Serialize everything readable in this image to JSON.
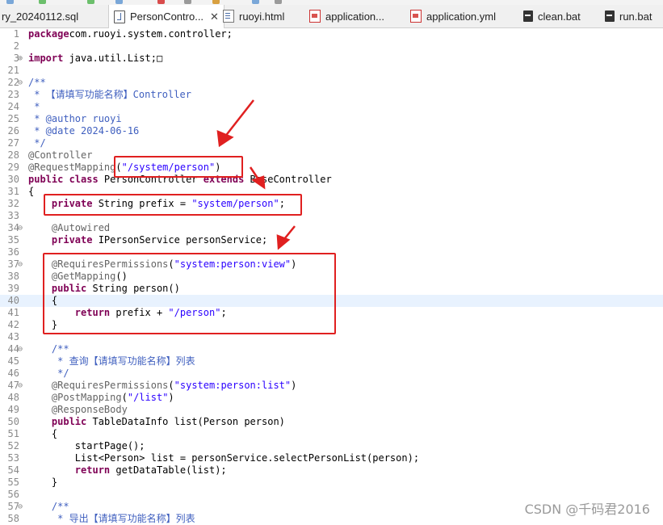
{
  "tabs": [
    {
      "label": "ry_20240112.sql",
      "icon": "none",
      "active": false
    },
    {
      "label": "PersonContro...",
      "icon": "java-file-icon",
      "active": true,
      "close": "✕"
    },
    {
      "label": "ruoyi.html",
      "icon": "html-file-icon",
      "active": false
    },
    {
      "label": "application...",
      "icon": "yml-file-icon",
      "active": false
    },
    {
      "label": "application.yml",
      "icon": "yml-file-icon",
      "active": false
    },
    {
      "label": "clean.bat",
      "icon": "bat-file-icon",
      "active": false
    },
    {
      "label": "run.bat",
      "icon": "bat-file-icon",
      "active": false
    }
  ],
  "editor": {
    "lines": [
      {
        "n": "1",
        "fold": "",
        "tokens": [
          [
            "kw",
            "package"
          ],
          [
            "",
            "com.ruoyi.system.controller;"
          ]
        ]
      },
      {
        "n": "2",
        "fold": "",
        "tokens": []
      },
      {
        "n": "3",
        "fold": "⊕",
        "tokens": [
          [
            "kw",
            "import"
          ],
          [
            "",
            " java.util.List;□"
          ]
        ]
      },
      {
        "n": "21",
        "fold": "",
        "tokens": []
      },
      {
        "n": "22",
        "fold": "⊖",
        "tokens": [
          [
            "jdoc",
            "/**"
          ]
        ]
      },
      {
        "n": "23",
        "fold": "",
        "tokens": [
          [
            "jdoc",
            " * 【请填写功能名称】Controller"
          ]
        ]
      },
      {
        "n": "24",
        "fold": "",
        "tokens": [
          [
            "jdoc",
            " *"
          ]
        ]
      },
      {
        "n": "25",
        "fold": "",
        "tokens": [
          [
            "jdoc",
            " * @author ruoyi"
          ]
        ]
      },
      {
        "n": "26",
        "fold": "",
        "tokens": [
          [
            "jdoc",
            " * @date 2024-06-16"
          ]
        ]
      },
      {
        "n": "27",
        "fold": "",
        "tokens": [
          [
            "jdoc",
            " */"
          ]
        ]
      },
      {
        "n": "28",
        "fold": "",
        "tokens": [
          [
            "ann",
            "@Controller"
          ]
        ]
      },
      {
        "n": "29",
        "fold": "",
        "tokens": [
          [
            "ann",
            "@RequestMapping"
          ],
          [
            "",
            "("
          ],
          [
            "str",
            "\"/system/person\""
          ],
          [
            "",
            ")"
          ]
        ]
      },
      {
        "n": "30",
        "fold": "",
        "tokens": [
          [
            "kw",
            "public class"
          ],
          [
            "",
            " PersonController "
          ],
          [
            "kw",
            "extends"
          ],
          [
            "",
            " BaseController"
          ]
        ]
      },
      {
        "n": "31",
        "fold": "",
        "tokens": [
          [
            "",
            "{"
          ]
        ]
      },
      {
        "n": "32",
        "fold": "",
        "tokens": [
          [
            "",
            "    "
          ],
          [
            "kw",
            "private"
          ],
          [
            "",
            " String prefix = "
          ],
          [
            "str",
            "\"system/person\""
          ],
          [
            "",
            ";"
          ]
        ]
      },
      {
        "n": "33",
        "fold": "",
        "tokens": []
      },
      {
        "n": "34",
        "fold": "⊖",
        "tokens": [
          [
            "",
            "    "
          ],
          [
            "ann",
            "@Autowired"
          ]
        ]
      },
      {
        "n": "35",
        "fold": "",
        "tokens": [
          [
            "",
            "    "
          ],
          [
            "kw",
            "private"
          ],
          [
            "",
            " IPersonService personService;"
          ]
        ]
      },
      {
        "n": "36",
        "fold": "",
        "tokens": []
      },
      {
        "n": "37",
        "fold": "⊖",
        "tokens": [
          [
            "",
            "    "
          ],
          [
            "ann",
            "@RequiresPermissions"
          ],
          [
            "",
            "("
          ],
          [
            "str",
            "\"system:person:view\""
          ],
          [
            "",
            ")"
          ]
        ]
      },
      {
        "n": "38",
        "fold": "",
        "tokens": [
          [
            "",
            "    "
          ],
          [
            "ann",
            "@GetMapping"
          ],
          [
            "",
            "()"
          ]
        ]
      },
      {
        "n": "39",
        "fold": "",
        "tokens": [
          [
            "",
            "    "
          ],
          [
            "kw",
            "public"
          ],
          [
            "",
            " String person()"
          ]
        ]
      },
      {
        "n": "40",
        "fold": "",
        "tokens": [
          [
            "",
            "    {"
          ]
        ],
        "current": true
      },
      {
        "n": "41",
        "fold": "",
        "tokens": [
          [
            "",
            "        "
          ],
          [
            "kw",
            "return"
          ],
          [
            "",
            " prefix + "
          ],
          [
            "str",
            "\"/person\""
          ],
          [
            "",
            ";"
          ]
        ]
      },
      {
        "n": "42",
        "fold": "",
        "tokens": [
          [
            "",
            "    }"
          ]
        ]
      },
      {
        "n": "43",
        "fold": "",
        "tokens": []
      },
      {
        "n": "44",
        "fold": "⊖",
        "tokens": [
          [
            "",
            "    "
          ],
          [
            "jdoc",
            "/**"
          ]
        ]
      },
      {
        "n": "45",
        "fold": "",
        "tokens": [
          [
            "",
            "    "
          ],
          [
            "jdoc",
            " * 查询【请填写功能名称】列表"
          ]
        ]
      },
      {
        "n": "46",
        "fold": "",
        "tokens": [
          [
            "",
            "    "
          ],
          [
            "jdoc",
            " */"
          ]
        ]
      },
      {
        "n": "47",
        "fold": "⊖",
        "tokens": [
          [
            "",
            "    "
          ],
          [
            "ann",
            "@RequiresPermissions"
          ],
          [
            "",
            "("
          ],
          [
            "str",
            "\"system:person:list\""
          ],
          [
            "",
            ")"
          ]
        ]
      },
      {
        "n": "48",
        "fold": "",
        "tokens": [
          [
            "",
            "    "
          ],
          [
            "ann",
            "@PostMapping"
          ],
          [
            "",
            "("
          ],
          [
            "str",
            "\"/list\""
          ],
          [
            "",
            ")"
          ]
        ]
      },
      {
        "n": "49",
        "fold": "",
        "tokens": [
          [
            "",
            "    "
          ],
          [
            "ann",
            "@ResponseBody"
          ]
        ]
      },
      {
        "n": "50",
        "fold": "",
        "tokens": [
          [
            "",
            "    "
          ],
          [
            "kw",
            "public"
          ],
          [
            "",
            " TableDataInfo list(Person person)"
          ]
        ]
      },
      {
        "n": "51",
        "fold": "",
        "tokens": [
          [
            "",
            "    {"
          ]
        ]
      },
      {
        "n": "52",
        "fold": "",
        "tokens": [
          [
            "",
            "        startPage();"
          ]
        ]
      },
      {
        "n": "53",
        "fold": "",
        "tokens": [
          [
            "",
            "        List<Person> list = personService.selectPersonList(person);"
          ]
        ]
      },
      {
        "n": "54",
        "fold": "",
        "tokens": [
          [
            "",
            "        "
          ],
          [
            "kw",
            "return"
          ],
          [
            "",
            " getDataTable(list);"
          ]
        ]
      },
      {
        "n": "55",
        "fold": "",
        "tokens": [
          [
            "",
            "    }"
          ]
        ]
      },
      {
        "n": "56",
        "fold": "",
        "tokens": []
      },
      {
        "n": "57",
        "fold": "⊖",
        "tokens": [
          [
            "",
            "    "
          ],
          [
            "jdoc",
            "/**"
          ]
        ]
      },
      {
        "n": "58",
        "fold": "",
        "tokens": [
          [
            "",
            "    "
          ],
          [
            "jdoc",
            " * 导出【请填写功能名称】列表"
          ]
        ]
      }
    ]
  },
  "watermark": "CSDN @千码君2016",
  "colors": {
    "highlight": "#e02020",
    "keyword": "#7f0055",
    "string": "#2a00ff",
    "javadoc": "#3f5fbf",
    "annotation": "#646464",
    "current_line": "#e8f2fe"
  }
}
